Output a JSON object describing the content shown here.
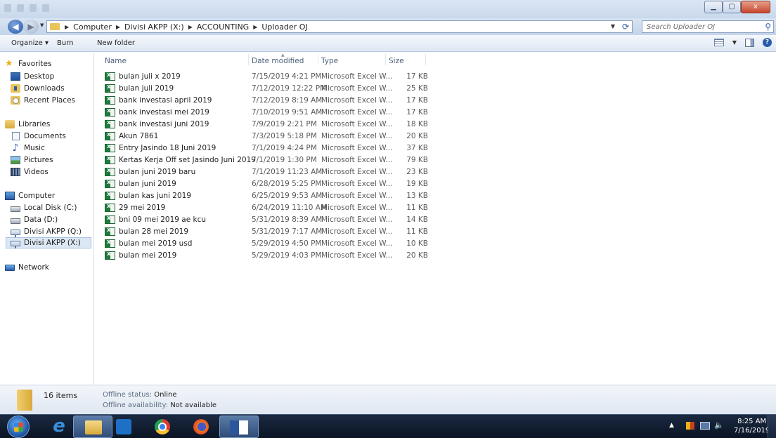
{
  "window": {
    "close_glyph": "x"
  },
  "address": {
    "crumbs": [
      "Computer",
      "Divisi AKPP (X:)",
      "ACCOUNTING",
      "Uploader OJ"
    ]
  },
  "search": {
    "placeholder": "Search Uploader OJ"
  },
  "toolbar": {
    "organize_label": "Organize ▾",
    "burn_label": "Burn",
    "new_folder_label": "New folder"
  },
  "sidebar": {
    "favorites": "Favorites",
    "desktop": "Desktop",
    "downloads": "Downloads",
    "recent": "Recent Places",
    "libraries": "Libraries",
    "documents": "Documents",
    "music": "Music",
    "pictures": "Pictures",
    "videos": "Videos",
    "computer": "Computer",
    "local_disk": "Local Disk (C:)",
    "data_d": "Data (D:)",
    "divisi_q": "Divisi AKPP (Q:)",
    "divisi_x": "Divisi AKPP (X:)",
    "network": "Network"
  },
  "columns": {
    "name": "Name",
    "date": "Date modified",
    "type": "Type",
    "size": "Size"
  },
  "files": [
    {
      "name": "bulan juli x 2019",
      "date": "7/15/2019 4:21 PM",
      "type": "Microsoft Excel W...",
      "size": "17 KB"
    },
    {
      "name": "bulan juli 2019",
      "date": "7/12/2019 12:22 PM",
      "type": "Microsoft Excel W...",
      "size": "25 KB"
    },
    {
      "name": "bank investasi april 2019",
      "date": "7/12/2019 8:19 AM",
      "type": "Microsoft Excel W...",
      "size": "17 KB"
    },
    {
      "name": "bank investasi mei 2019",
      "date": "7/10/2019 9:51 AM",
      "type": "Microsoft Excel W...",
      "size": "17 KB"
    },
    {
      "name": "bank investasi juni 2019",
      "date": "7/9/2019 2:21 PM",
      "type": "Microsoft Excel W...",
      "size": "18 KB"
    },
    {
      "name": "Akun 7861",
      "date": "7/3/2019 5:18 PM",
      "type": "Microsoft Excel W...",
      "size": "20 KB"
    },
    {
      "name": "Entry Jasindo 18 Juni 2019",
      "date": "7/1/2019 4:24 PM",
      "type": "Microsoft Excel W...",
      "size": "37 KB"
    },
    {
      "name": "Kertas Kerja Off set Jasindo Juni 2019",
      "date": "7/1/2019 1:30 PM",
      "type": "Microsoft Excel W...",
      "size": "79 KB"
    },
    {
      "name": "bulan juni 2019 baru",
      "date": "7/1/2019 11:23 AM",
      "type": "Microsoft Excel W...",
      "size": "23 KB"
    },
    {
      "name": "bulan juni 2019",
      "date": "6/28/2019 5:25 PM",
      "type": "Microsoft Excel W...",
      "size": "19 KB"
    },
    {
      "name": "bulan kas juni 2019",
      "date": "6/25/2019 9:53 AM",
      "type": "Microsoft Excel W...",
      "size": "13 KB"
    },
    {
      "name": "29 mei 2019",
      "date": "6/24/2019 11:10 AM",
      "type": "Microsoft Excel W...",
      "size": "11 KB"
    },
    {
      "name": "bni 09 mei 2019 ae kcu",
      "date": "5/31/2019 8:39 AM",
      "type": "Microsoft Excel W...",
      "size": "14 KB"
    },
    {
      "name": "bulan 28 mei 2019",
      "date": "5/31/2019 7:17 AM",
      "type": "Microsoft Excel W...",
      "size": "11 KB"
    },
    {
      "name": "bulan mei 2019 usd",
      "date": "5/29/2019 4:50 PM",
      "type": "Microsoft Excel W...",
      "size": "10 KB"
    },
    {
      "name": "bulan mei 2019",
      "date": "5/29/2019 4:03 PM",
      "type": "Microsoft Excel W...",
      "size": "20 KB"
    }
  ],
  "details": {
    "item_count": "16 items",
    "offline_status_label": "Offline status:",
    "offline_status_value": "Online",
    "offline_avail_label": "Offline availability:",
    "offline_avail_value": "Not available"
  },
  "clock": {
    "time": "8:25 AM",
    "date": "7/16/2019"
  }
}
